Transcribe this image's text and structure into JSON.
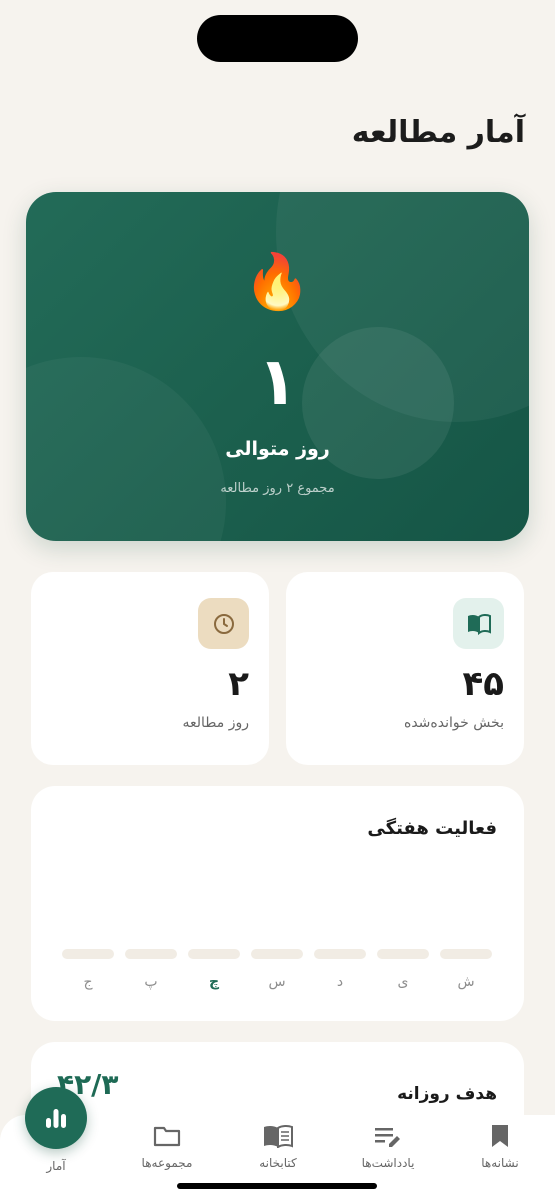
{
  "header": {
    "title": "آمار مطالعه"
  },
  "streak": {
    "icon": "fire-icon",
    "emoji": "🔥",
    "value": "۱",
    "label": "روز متوالی",
    "subtitle": "مجموع ۲ روز مطالعه"
  },
  "stats": [
    {
      "icon": "open-book-icon",
      "value": "۴۵",
      "label": "بخش خوانده‌شده"
    },
    {
      "icon": "clock-icon",
      "value": "۲",
      "label": "روز مطالعه"
    }
  ],
  "weekly": {
    "title": "فعالیت هفتگی",
    "days": [
      "ش",
      "ی",
      "د",
      "س",
      "چ",
      "پ",
      "ج"
    ],
    "active_day": "چ"
  },
  "goal": {
    "title": "هدف روزانه",
    "value": "۴۲/۳"
  },
  "tabs": [
    {
      "icon": "bookmark-icon",
      "label": "نشانه‌ها"
    },
    {
      "icon": "notes-icon",
      "label": "یادداشت‌ها"
    },
    {
      "icon": "library-book-icon",
      "label": "کتابخانه"
    },
    {
      "icon": "folder-icon",
      "label": "مجموعه‌ها"
    },
    {
      "icon": "stats-icon",
      "label": "آمار",
      "active": true
    }
  ],
  "colors": {
    "accent": "#1f6b57",
    "background": "#f6f3ee",
    "hero": "#1b5f4d"
  }
}
